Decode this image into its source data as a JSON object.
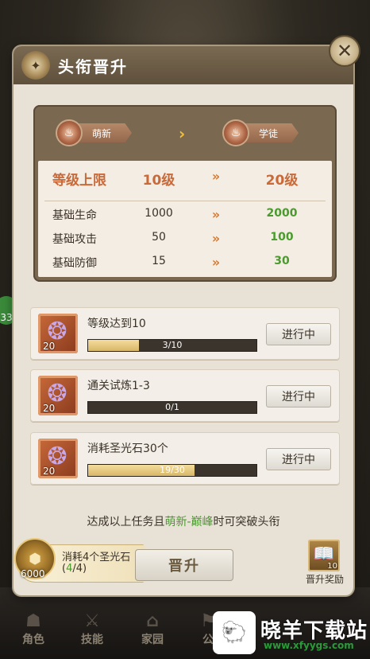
{
  "panel": {
    "title": "头衔晋升"
  },
  "ranks": {
    "current": "萌新",
    "next": "学徒"
  },
  "stats": [
    {
      "label": "等级上限",
      "current": "10级",
      "next": "20级"
    },
    {
      "label": "基础生命",
      "current": "1000",
      "next": "2000"
    },
    {
      "label": "基础攻击",
      "current": "50",
      "next": "100"
    },
    {
      "label": "基础防御",
      "current": "15",
      "next": "30"
    }
  ],
  "tasks": [
    {
      "name": "等级达到10",
      "icon_count": "20",
      "progress": "3/10",
      "progress_fraction": 0.3,
      "button": "进行中"
    },
    {
      "name": "通关试炼1-3",
      "icon_count": "20",
      "progress": "0/1",
      "progress_fraction": 0,
      "button": "进行中"
    },
    {
      "name": "消耗圣光石30个",
      "icon_count": "20",
      "progress": "19/30",
      "progress_fraction": 0.633,
      "button": "进行中"
    }
  ],
  "hint": {
    "before": "达成以上任务且",
    "highlight": "萌新-巅峰",
    "after": "时可突破头衔"
  },
  "cost": {
    "label": "消耗4个圣光石",
    "count_open": "(",
    "count_have": "4",
    "count_need": "/4)",
    "amount": "6000"
  },
  "promote_button": "晋升",
  "reward": {
    "count": "10",
    "label": "晋升奖励"
  },
  "side_badge": "33",
  "nav": [
    "角色",
    "技能",
    "家园",
    "公"
  ],
  "watermark": {
    "title": "晓羊下载站",
    "url": "www.xfyygs.com"
  },
  "icons": {
    "close": "close-icon",
    "emblem": "emblem-icon",
    "rank": "rank-icon",
    "gem": "dragon-gem-icon",
    "coin": "holy-stone-icon",
    "book": "book-icon"
  },
  "colors": {
    "accent_orange": "#c86a3a",
    "green": "#4a9a2e",
    "arrow": "#d87a30",
    "gold": "#f0c030"
  }
}
